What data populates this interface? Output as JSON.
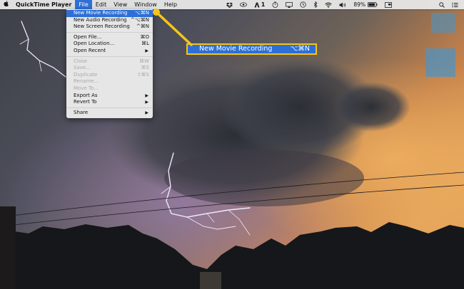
{
  "menubar": {
    "app_name": "QuickTime Player",
    "menus": [
      "File",
      "Edit",
      "View",
      "Window",
      "Help"
    ],
    "status": {
      "adobe_badge": "1",
      "battery": "89%"
    }
  },
  "file_menu": {
    "items": [
      {
        "label": "New Movie Recording",
        "shortcut": "⌥⌘N"
      },
      {
        "label": "New Audio Recording",
        "shortcut": "^⌥⌘N"
      },
      {
        "label": "New Screen Recording",
        "shortcut": "^⌘N"
      },
      {
        "label": "Open File...",
        "shortcut": "⌘O"
      },
      {
        "label": "Open Location...",
        "shortcut": "⌘L"
      },
      {
        "label": "Open Recent",
        "shortcut": "▶"
      },
      {
        "label": "Close",
        "shortcut": "⌘W"
      },
      {
        "label": "Save...",
        "shortcut": "⌘S"
      },
      {
        "label": "Duplicate",
        "shortcut": "⇧⌘S"
      },
      {
        "label": "Rename...",
        "shortcut": ""
      },
      {
        "label": "Move To...",
        "shortcut": ""
      },
      {
        "label": "Export As",
        "shortcut": "▶"
      },
      {
        "label": "Revert To",
        "shortcut": "▶"
      },
      {
        "label": "Share",
        "shortcut": "▶"
      }
    ]
  },
  "callout": {
    "label": "New Movie Recording",
    "shortcut": "⌥⌘N"
  },
  "colors": {
    "highlight": "#2d6fd6",
    "callout_border": "#f5c518"
  }
}
